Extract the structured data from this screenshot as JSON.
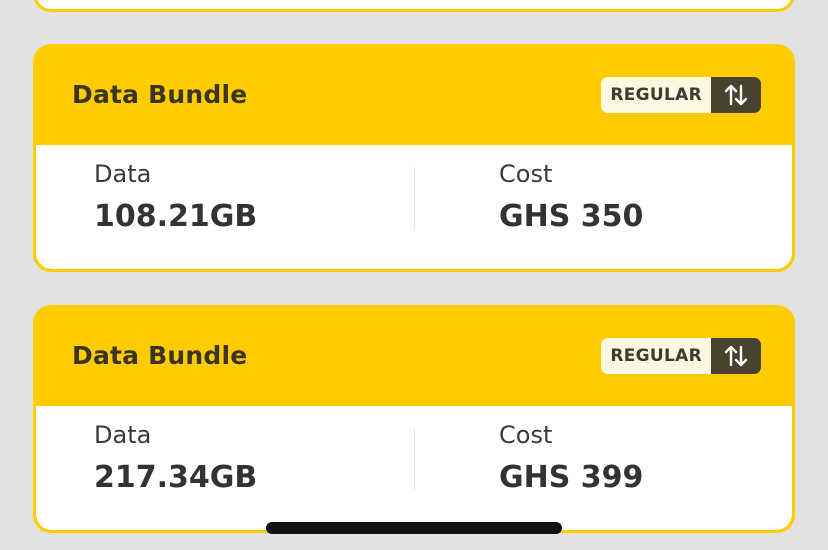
{
  "bundles": [
    {
      "title": "Data Bundle",
      "plan_type": "REGULAR",
      "data_label": "Data",
      "data_value": "108.21GB",
      "cost_label": "Cost",
      "cost_value": "GHS 350"
    },
    {
      "title": "Data Bundle",
      "plan_type": "REGULAR",
      "data_label": "Data",
      "data_value": "217.34GB",
      "cost_label": "Cost",
      "cost_value": "GHS 399"
    }
  ],
  "colors": {
    "accent": "#ffcc00",
    "background": "#e2e2e2",
    "toggle_dark": "#4a4230"
  },
  "icons": {
    "swap": "swap-vertical-icon"
  }
}
